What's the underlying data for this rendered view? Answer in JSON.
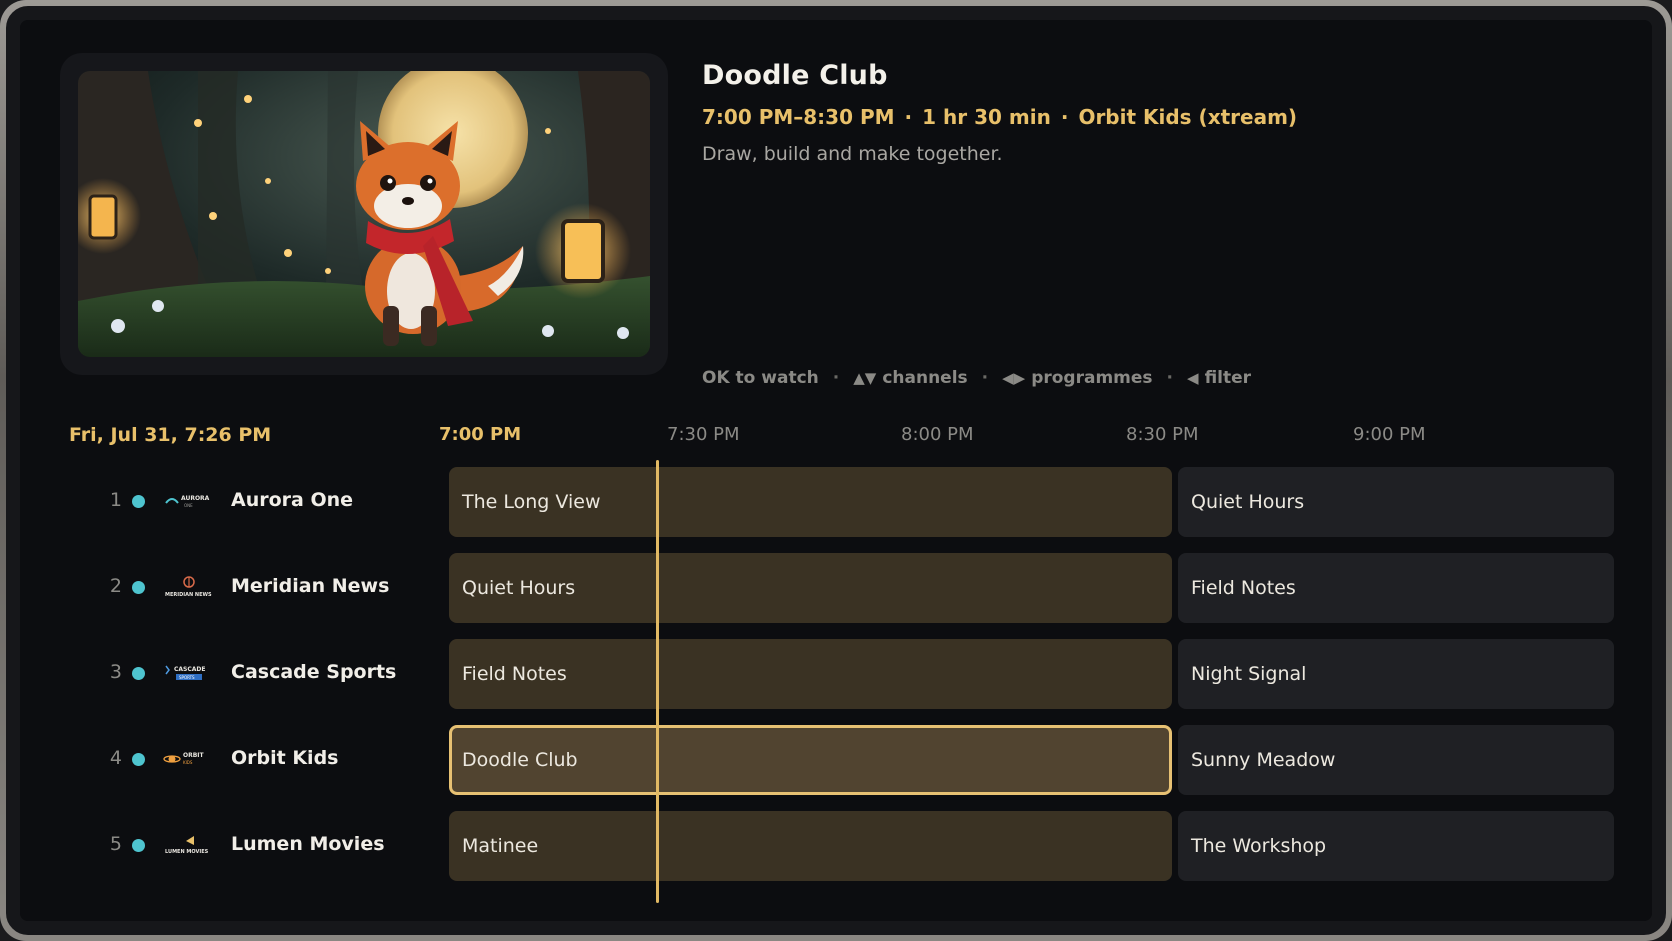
{
  "hero": {
    "image_alt": "",
    "program": {
      "title": "Doodle Club",
      "time_range": "7:00 PM–8:30 PM",
      "duration": "1 hr 30 min",
      "channel": "Orbit Kids",
      "source": "(xtream)",
      "description": "Draw, build and make together."
    }
  },
  "hints": [
    {
      "icon": "",
      "label": "OK to watch"
    },
    {
      "icon": "up-down-arrows-icon",
      "label": "channels"
    },
    {
      "icon": "left-right-arrows-icon",
      "label": "programmes"
    },
    {
      "icon": "left-arrow-icon",
      "label": "filter"
    }
  ],
  "guide": {
    "current_datetime": "Fri, Jul 31, 7:26 PM",
    "timeline": [
      "7:00 PM",
      "7:30 PM",
      "8:00 PM",
      "8:30 PM",
      "9:00 PM"
    ],
    "channels": [
      {
        "number": "1",
        "name": "Aurora One",
        "logo_text": "AURORA",
        "logo_sub": "ONE",
        "programs": [
          "The Long View",
          "Quiet Hours"
        ]
      },
      {
        "number": "2",
        "name": "Meridian News",
        "logo_text": "MERIDIAN NEWS",
        "logo_sub": "",
        "programs": [
          "Quiet Hours",
          "Field Notes"
        ]
      },
      {
        "number": "3",
        "name": "Cascade Sports",
        "logo_text": "CASCADE",
        "logo_sub": "SPORTS",
        "programs": [
          "Field Notes",
          "Night Signal"
        ]
      },
      {
        "number": "4",
        "name": "Orbit Kids",
        "logo_text": "ORBIT",
        "logo_sub": "KIDS",
        "programs": [
          "Doodle Club",
          "Sunny Meadow"
        ]
      },
      {
        "number": "5",
        "name": "Lumen Movies",
        "logo_text": "LUMEN MOVIES",
        "logo_sub": "",
        "programs": [
          "Matinee",
          "The Workshop"
        ]
      }
    ],
    "selected_channel_index": 3,
    "colors": {
      "accent": "#e8c06a",
      "status_dot": "#4ec4cf",
      "current_block": "#3a3223",
      "next_block": "#1f2024"
    }
  }
}
